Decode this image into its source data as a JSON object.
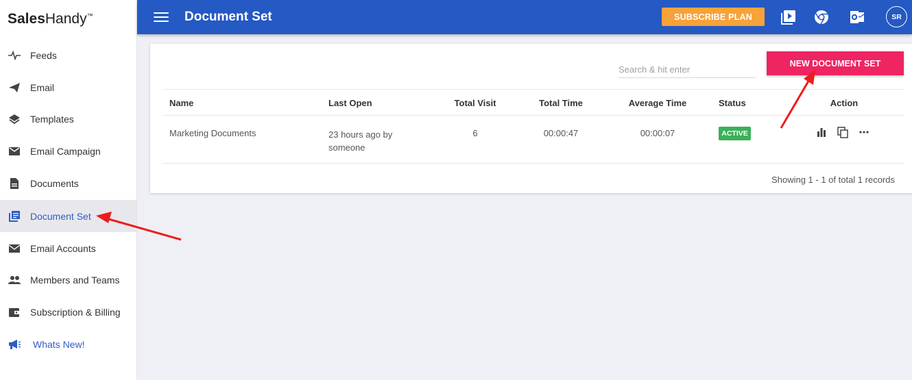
{
  "brand": {
    "name_bold": "Sales",
    "name_regular": "Handy",
    "tm": "™"
  },
  "header": {
    "title": "Document Set",
    "subscribe_label": "SUBSCRIBE PLAN",
    "avatar_initials": "SR",
    "color": "#2559c3"
  },
  "sidebar": {
    "items": [
      {
        "label": "Feeds",
        "icon": "pulse-icon"
      },
      {
        "label": "Email",
        "icon": "send-icon"
      },
      {
        "label": "Templates",
        "icon": "layers-icon"
      },
      {
        "label": "Email Campaign",
        "icon": "mail-box-icon"
      },
      {
        "label": "Documents",
        "icon": "document-icon"
      },
      {
        "label": "Document Set",
        "icon": "library-icon",
        "active": true
      },
      {
        "label": "Email Accounts",
        "icon": "envelope-icon"
      },
      {
        "label": "Members and Teams",
        "icon": "people-icon"
      },
      {
        "label": "Subscription & Billing",
        "icon": "wallet-icon"
      },
      {
        "label": "Whats New!",
        "icon": "megaphone-icon"
      }
    ]
  },
  "toolbar": {
    "search_placeholder": "Search & hit enter",
    "new_button_label": "NEW DOCUMENT SET",
    "new_button_color": "#ef2462"
  },
  "table": {
    "columns": [
      "Name",
      "Last Open",
      "Total Visit",
      "Total Time",
      "Average Time",
      "Status",
      "Action"
    ],
    "rows": [
      {
        "name": "Marketing Documents",
        "last_open_line1": "23 hours ago by",
        "last_open_line2": "someone",
        "total_visit": "6",
        "total_time": "00:00:47",
        "average_time": "00:00:07",
        "status": "ACTIVE",
        "status_color": "#3bb05a",
        "actions": [
          "bar-chart-icon",
          "copy-icon",
          "more-horizontal-icon"
        ]
      }
    ]
  },
  "footer": {
    "records_text": "Showing 1 - 1 of total 1 records"
  }
}
